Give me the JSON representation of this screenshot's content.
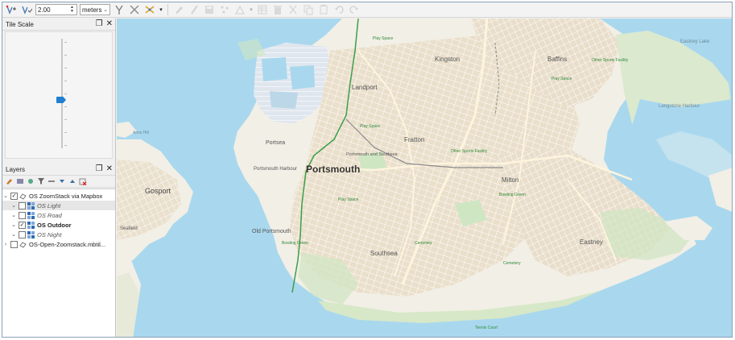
{
  "toolbar": {
    "tolerance_value": "2.00",
    "units_value": "meters",
    "icons": [
      "vertex-tool-icon",
      "vertex-tool-selected-icon",
      "split-icon",
      "scissors-icon",
      "trim-icon",
      "edit-icon",
      "pencil-icon",
      "save-edits-icon",
      "add-point-icon",
      "digitize-icon",
      "delete-icon",
      "cut-icon",
      "copy-icon",
      "paste-icon",
      "undo-icon",
      "redo-icon"
    ]
  },
  "tile_scale": {
    "title": "Tile Scale"
  },
  "layers": {
    "title": "Layers",
    "items": [
      {
        "label": "OS ZoomStack via Mapbox",
        "checked": true,
        "expanded": true
      },
      {
        "label": "OS Light",
        "checked": false
      },
      {
        "label": "OS Road",
        "checked": false
      },
      {
        "label": "OS Outdoor",
        "checked": true
      },
      {
        "label": "OS Night",
        "checked": false
      },
      {
        "label": "OS-Open-Zoomstack.mbtil...",
        "checked": false,
        "expanded": false
      }
    ]
  },
  "map": {
    "colors": {
      "water": "#a9d8ee",
      "land": "#f2efe6",
      "urban": "#e8dfcd",
      "park": "#cfe6c2",
      "road": "#ffffff",
      "rail": "#3c9e4b"
    },
    "labels": {
      "portsmouth": "Portsmouth",
      "gosport": "Gosport",
      "southsea": "Southsea",
      "fratton": "Fratton",
      "milton": "Milton",
      "eastney": "Eastney",
      "kingston": "Kingston",
      "baffins": "Baffins",
      "landport": "Landport",
      "portsea": "Portsea",
      "old_portsmouth": "Old Portsmouth",
      "portsmouth_harbour": "Portsmouth Harbour",
      "portsmouth_and_southsea": "Portsmouth and Southsea",
      "seafield": "Seafield",
      "langstone_harbour": "Langstone Harbour",
      "eastney_lake": "Eastney Lake",
      "anns_hill": "Anns Hill",
      "play_space": "Play Space",
      "cemetery": "Cemetery",
      "other_sports_facility": "Other Sports Facility",
      "tennis_court": "Tennis Court",
      "bowling_green": "Bowling Green"
    }
  }
}
